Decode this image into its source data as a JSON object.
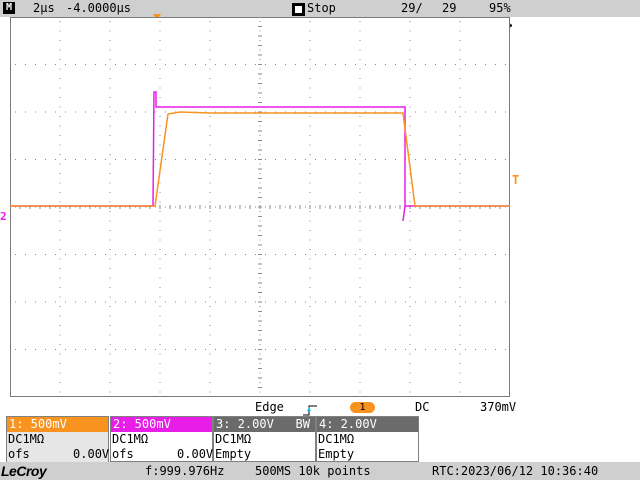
{
  "topbar": {
    "mode_icon": "M",
    "timebase": "2µs",
    "delay": "-4.0000µs",
    "run_state": "Stop",
    "acq_count": "29/",
    "acq_total": "29",
    "zoom": "95%"
  },
  "colors": {
    "ch1": "#f7931e",
    "ch2": "#e81ee8",
    "ch3": "#ffffff",
    "ch4": "#6b6b6b",
    "grid": "#8a8a8a"
  },
  "markers": {
    "ch2": "2",
    "trigger_level": "T"
  },
  "trigger": {
    "type": "Edge",
    "slope_icon": "rising-edge-icon",
    "source": "1",
    "coupling": "DC",
    "level": "370mV"
  },
  "channels": [
    {
      "header": "1: 500mV",
      "line1": "DC1MΩ",
      "line2": "ofs      0.00V"
    },
    {
      "header": "2: 500mV",
      "line1": "DC1MΩ",
      "line2": "ofs      0.00V"
    },
    {
      "header": "3: 2.00V   BW",
      "line1": "DC1MΩ",
      "line2": "Empty"
    },
    {
      "header": "4: 2.00V",
      "line1": "DC1MΩ",
      "line2": "Empty"
    }
  ],
  "bottombar": {
    "brand": "LeCroy",
    "frequency": "f:999.976Hz",
    "sampling": "500MS 10k points",
    "rtc": "RTC:2023/06/12 10:36:40"
  }
}
